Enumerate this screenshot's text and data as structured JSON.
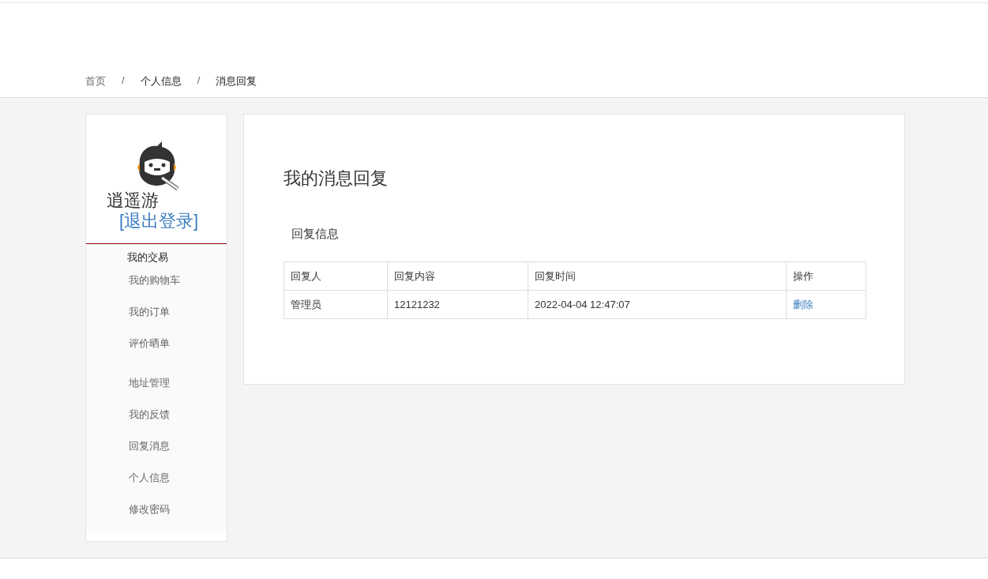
{
  "breadcrumb": [
    {
      "label": "首页",
      "current": false
    },
    {
      "label": "个人信息",
      "current": true
    },
    {
      "label": "消息回复",
      "current": true
    }
  ],
  "breadcrumb_separator": "/",
  "user": {
    "name": "逍遥游",
    "logout": "[退出登录]"
  },
  "sidebar": {
    "sections": [
      {
        "title": "我的交易",
        "items": [
          "我的购物车",
          "我的订单",
          "评价晒单"
        ]
      },
      {
        "items": [
          "地址管理",
          "我的反馈",
          "回复消息",
          "个人信息",
          "修改密码"
        ]
      }
    ]
  },
  "main": {
    "title": "我的消息回复",
    "subtitle": "回复信息",
    "table": {
      "columns": [
        "回复人",
        "回复内容",
        "回复时间",
        "操作"
      ],
      "rows": [
        {
          "cells": [
            "管理员",
            "12121232",
            "2022-04-04 12:47:07"
          ],
          "action": "删除"
        }
      ]
    }
  }
}
